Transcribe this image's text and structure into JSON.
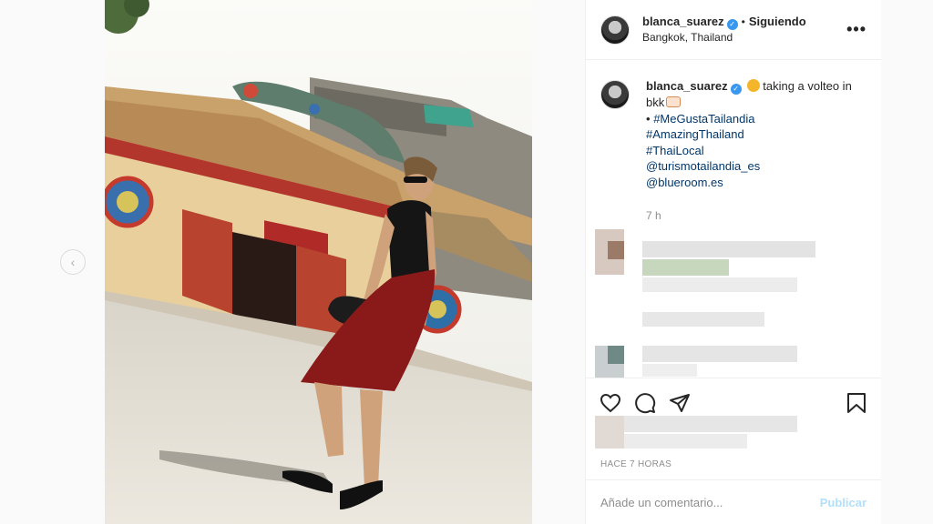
{
  "post": {
    "username": "blanca_suarez",
    "verified_mark": "✓",
    "separator": "•",
    "follow_status": "Siguiendo",
    "location": "Bangkok, Thailand",
    "more_label": "•••",
    "prev_label": "‹"
  },
  "caption": {
    "username": "blanca_suarez",
    "text_part1": "taking a volteo in",
    "text_part2": "bkk",
    "bullet": "•",
    "hashtags": [
      "#MeGustaTailandia",
      "#AmazingThailand",
      "#ThaiLocal"
    ],
    "mentions": [
      "@turismotailandia_es",
      "@blueroom.es"
    ],
    "time": "7 h"
  },
  "actions": {
    "icons": [
      "heart-icon",
      "comment-icon",
      "share-icon",
      "bookmark-icon"
    ]
  },
  "footer": {
    "posted_ago": "HACE 7 HORAS",
    "comment_placeholder": "Añade un comentario...",
    "publish_label": "Publicar"
  },
  "colors": {
    "link": "#00376b",
    "verified": "#3897f0",
    "publish_disabled": "#b2dffc",
    "skirt": "#8a1a1a"
  }
}
